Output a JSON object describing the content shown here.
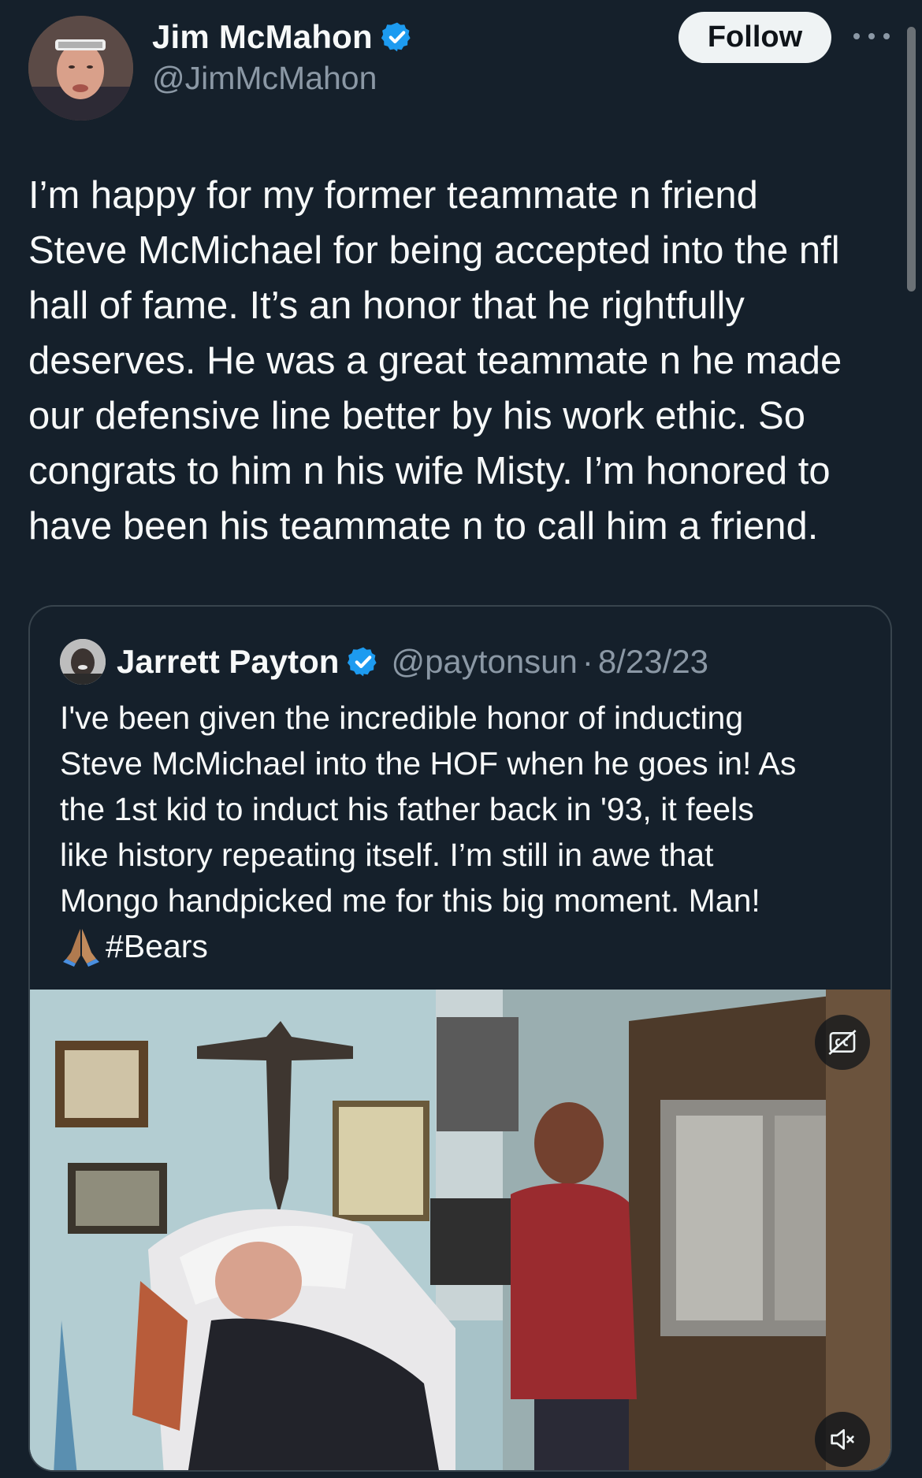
{
  "author": {
    "display_name": "Jim McMahon",
    "handle": "@JimMcMahon",
    "verified": true
  },
  "actions": {
    "follow_label": "Follow",
    "more_icon": "more-horizontal-icon"
  },
  "tweet": {
    "text": "I’m happy for my former teammate n friend\nSteve McMichael for being accepted into the nfl\nhall of fame. It’s an honor that he rightfully\ndeserves. He was a great teammate n he made\nour defensive line better by his work ethic. So\ncongrats to him n his wife Misty. I’m honored to\nhave been his teammate n to call him a friend."
  },
  "quoted_tweet": {
    "display_name": "Jarrett Payton",
    "handle": "@paytonsun",
    "separator": "·",
    "date": "8/23/23",
    "verified": true,
    "text": "I've been given the incredible honor of inducting\nSteve McMichael into the HOF when he goes in! As\nthe 1st kid to induct his father back in '93, it feels\nlike history repeating itself. I’m still in awe that\nMongo handpicked me for this big moment. Man!\n",
    "emoji": "🙏🏽",
    "hashtag": "#Bears",
    "media": {
      "type": "video",
      "captions_icon": "closed-captions-off-icon",
      "mute_icon": "volume-muted-icon"
    }
  },
  "colors": {
    "background": "#15202b",
    "text_primary": "#f7f9f9",
    "text_secondary": "#8b98a5",
    "verified_blue": "#1d9bf0",
    "border": "#38444d",
    "follow_bg": "#eff3f4"
  }
}
